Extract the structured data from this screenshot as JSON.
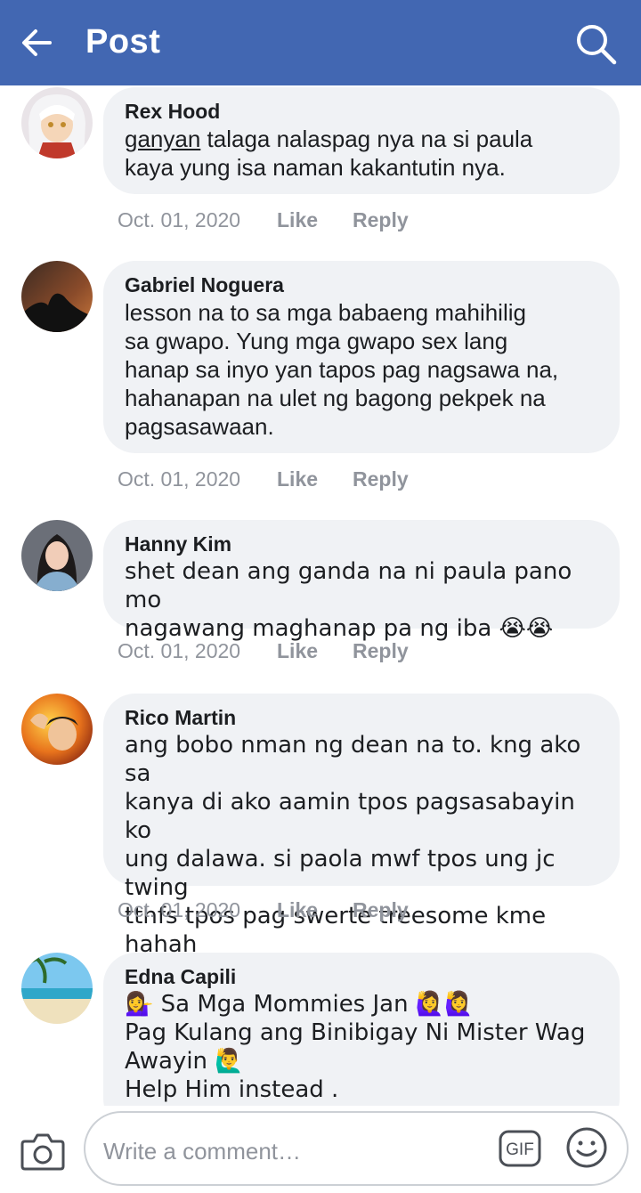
{
  "header": {
    "title": "Post",
    "back_icon": "arrow-left-icon",
    "search_icon": "search-icon",
    "background": "#4267b2"
  },
  "comments": [
    {
      "author": "Rex Hood",
      "text_underlined": "ganyan",
      "text": " talaga nalaspag nya na si paula\nkaya yung isa naman kakantutin nya.",
      "date": "Oct. 01, 2020",
      "like": "Like",
      "reply": "Reply"
    },
    {
      "author": "Gabriel Noguera",
      "text": "lesson na to sa mga babaeng mahihilig\nsa gwapo. Yung mga gwapo sex lang\nhanap sa inyo yan tapos pag nagsawa na,\nhahanapan na ulet ng bagong pekpek na\npagsasawaan.",
      "date": "Oct. 01, 2020",
      "like": "Like",
      "reply": "Reply"
    },
    {
      "author": "Hanny Kim",
      "text": "shet dean ang ganda na ni paula pano mo\nnagawang maghanap pa ng iba 😭😭",
      "date": "Oct. 01, 2020",
      "like": "Like",
      "reply": "Reply"
    },
    {
      "author": "Rico Martin",
      "text": "ang bobo nman ng dean na to. kng ako sa\nkanya di ako aamin tpos pagsasabayin ko\nung dalawa. si paola mwf tpos ung jc twing\ntthfs tpos pag swerte treesome kme hahah\nsarap 👅",
      "date": "Oct. 01, 2020",
      "like": "Like",
      "reply": "Reply"
    },
    {
      "author": "Edna Capili",
      "text": "💁‍♀️ Sa Mga Mommies Jan 🙋‍♀️🙋‍♀️\nPag Kulang ang Binibigay Ni Mister Wag\nAwayin 🙋‍♂️\nHelp Him  instead ."
    }
  ],
  "composer": {
    "placeholder": "Write a comment…",
    "camera_icon": "camera-icon",
    "gif_label": "GIF",
    "emoji_icon": "smiley-icon"
  }
}
